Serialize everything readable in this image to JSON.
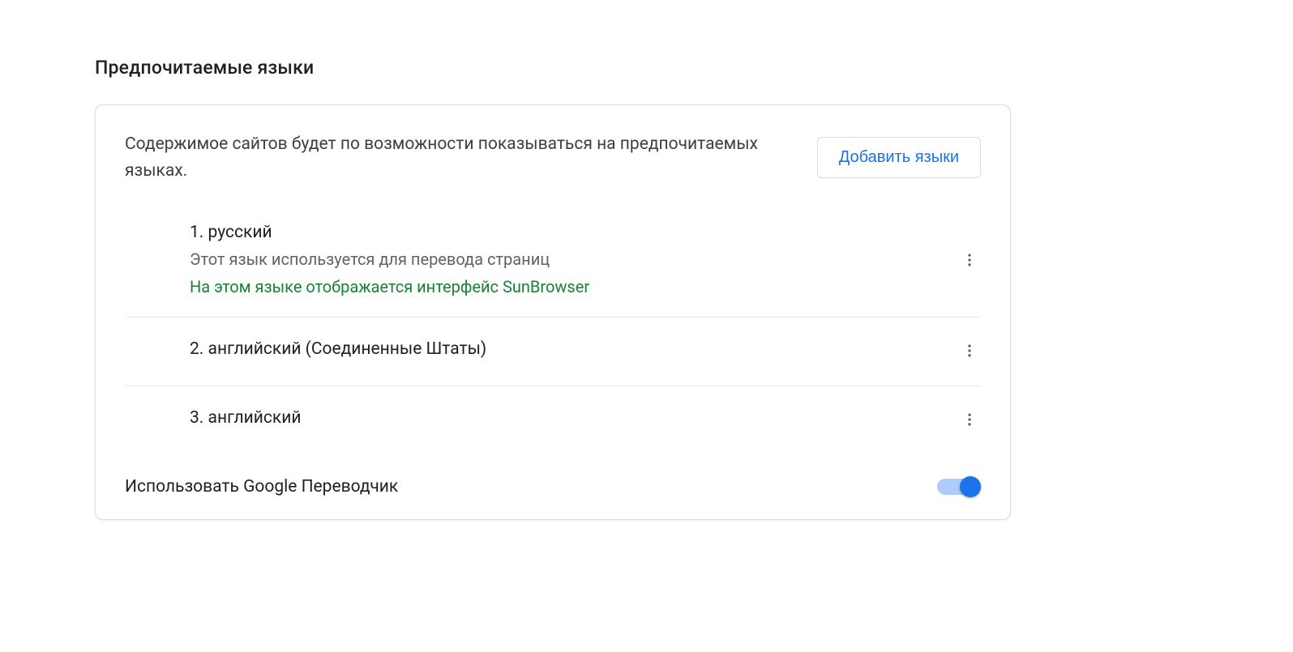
{
  "section": {
    "title": "Предпочитаемые языки"
  },
  "card": {
    "description": "Содержимое сайтов будет по возможности показываться на предпочитаемых языках.",
    "add_button": "Добавить языки"
  },
  "languages": [
    {
      "label": "1. русский",
      "sub_gray": "Этот язык используется для перевода страниц",
      "sub_green": "На этом языке отображается интерфейс SunBrowser"
    },
    {
      "label": "2. английский (Соединенные Штаты)",
      "sub_gray": "",
      "sub_green": ""
    },
    {
      "label": "3. английский",
      "sub_gray": "",
      "sub_green": ""
    }
  ],
  "toggle": {
    "label": "Использовать Google Переводчик",
    "on": true
  }
}
